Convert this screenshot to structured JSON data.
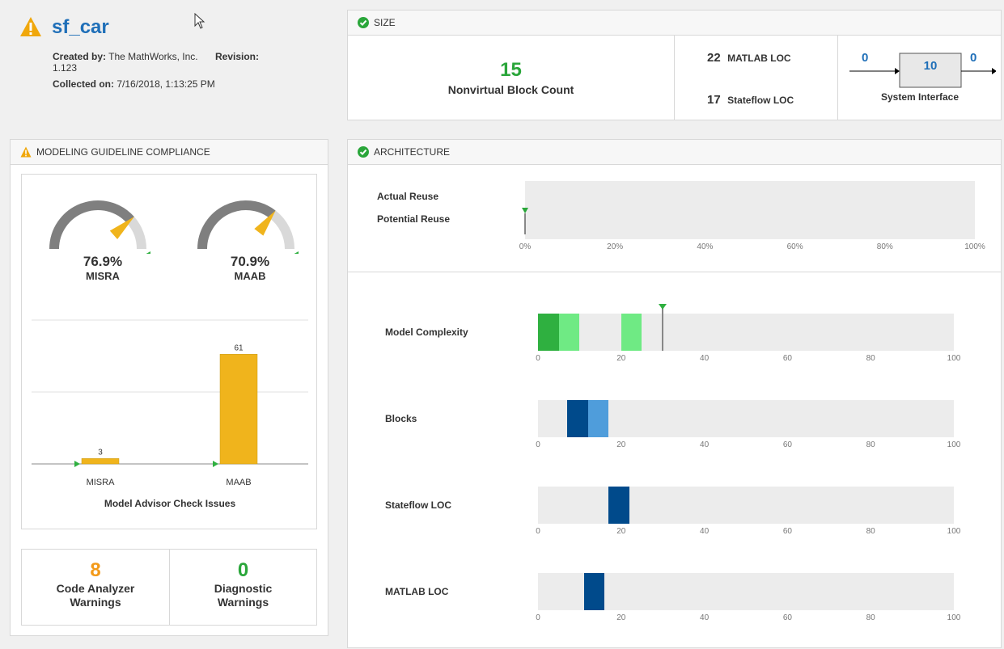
{
  "header": {
    "model_name": "sf_car",
    "created_by_label": "Created by:",
    "created_by": "The MathWorks, Inc.",
    "revision_label": "Revision:",
    "revision": "1.123",
    "collected_label": "Collected on:",
    "collected_on": "7/16/2018, 1:13:25 PM"
  },
  "size": {
    "title": "SIZE",
    "block_count": "15",
    "block_count_label": "Nonvirtual Block Count",
    "matlab_loc": "22",
    "matlab_loc_label": "MATLAB LOC",
    "stateflow_loc": "17",
    "stateflow_loc_label": "Stateflow LOC",
    "iface_inputs": "0",
    "iface_blocks": "10",
    "iface_outputs": "0",
    "iface_label": "System Interface"
  },
  "compliance": {
    "title": "MODELING GUIDELINE COMPLIANCE",
    "gauges": [
      {
        "value": "76.9%",
        "label": "MISRA",
        "fraction": 0.769,
        "threshold": 1.0
      },
      {
        "value": "70.9%",
        "label": "MAAB",
        "fraction": 0.709,
        "threshold": 1.0
      }
    ],
    "issues_chart_title": "Model Advisor Check Issues",
    "code_analyzer_count": "8",
    "code_analyzer_label": "Code Analyzer Warnings",
    "diagnostic_count": "0",
    "diagnostic_label": "Diagnostic Warnings"
  },
  "architecture": {
    "title": "ARCHITECTURE",
    "reuse": {
      "actual_label": "Actual Reuse",
      "potential_label": "Potential Reuse",
      "ticks": [
        "0%",
        "20%",
        "40%",
        "60%",
        "80%",
        "100%"
      ]
    },
    "axis_ticks": [
      "0",
      "20",
      "40",
      "60",
      "80",
      "100"
    ]
  },
  "colors": {
    "green_dark": "#2fb040",
    "green_light": "#6fea84",
    "blue_dark": "#004a8b",
    "blue_light": "#4f9ddb",
    "amber": "#f0b41c",
    "gauge_gray": "#7f7f7f",
    "orange_text": "#f39a1a",
    "green_text": "#2aa63a"
  },
  "chart_data": [
    {
      "type": "bar",
      "title": "Model Advisor Check Issues",
      "categories": [
        "MISRA",
        "MAAB"
      ],
      "values": [
        3,
        61
      ],
      "ylim": [
        0,
        80
      ]
    },
    {
      "type": "bar",
      "title": "Model Complexity",
      "xlim": [
        0,
        100
      ],
      "segments": [
        [
          0,
          5,
          "#2fb040"
        ],
        [
          5,
          10,
          "#6fea84"
        ],
        [
          20,
          25,
          "#6fea84"
        ]
      ],
      "marker": 30
    },
    {
      "type": "bar",
      "title": "Blocks",
      "xlim": [
        0,
        100
      ],
      "segments": [
        [
          7,
          12,
          "#004a8b"
        ],
        [
          12,
          17,
          "#4f9ddb"
        ]
      ]
    },
    {
      "type": "bar",
      "title": "Stateflow LOC",
      "xlim": [
        0,
        100
      ],
      "segments": [
        [
          17,
          22,
          "#004a8b"
        ]
      ]
    },
    {
      "type": "bar",
      "title": "MATLAB LOC",
      "xlim": [
        0,
        100
      ],
      "segments": [
        [
          11,
          16,
          "#004a8b"
        ]
      ]
    }
  ]
}
